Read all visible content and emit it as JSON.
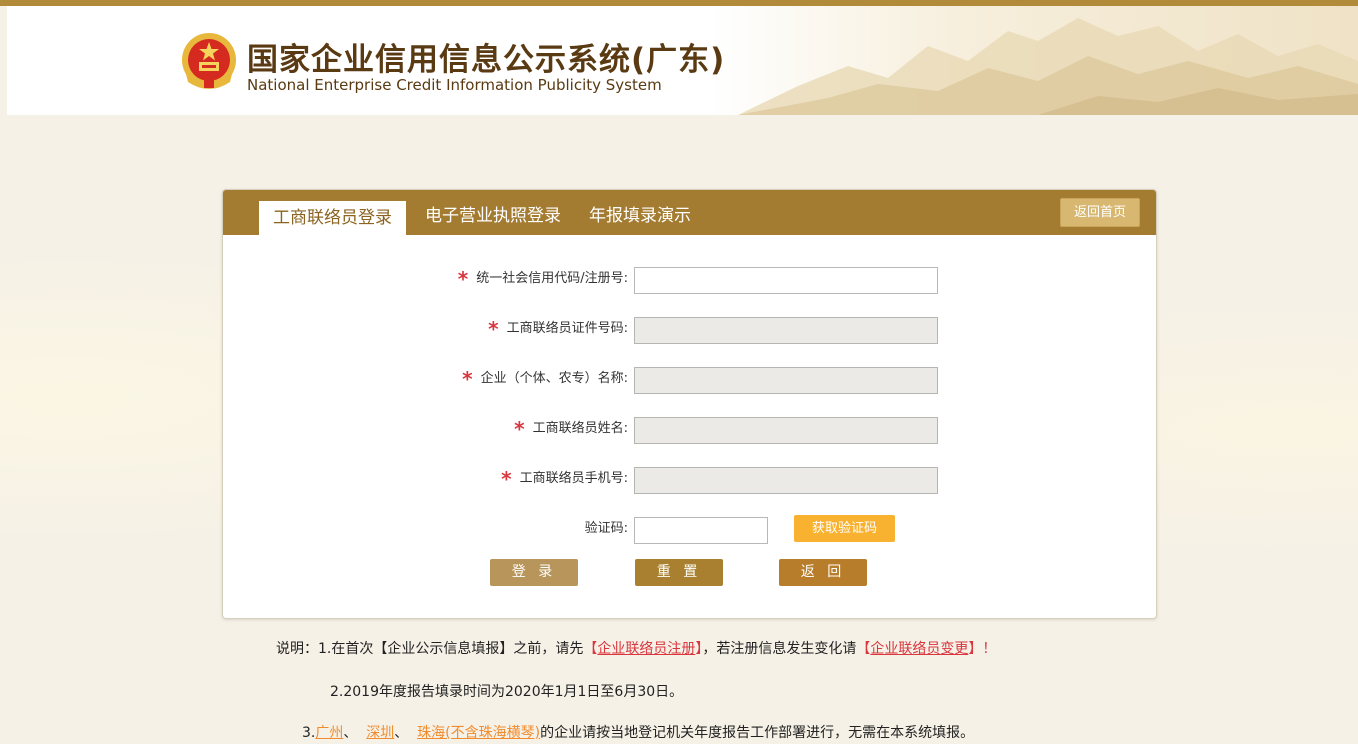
{
  "header": {
    "title": "国家企业信用信息公示系统(广东)",
    "subtitle": "National Enterprise Credit Information Publicity System"
  },
  "tabs": [
    {
      "label": "工商联络员登录",
      "active": true
    },
    {
      "label": "电子营业执照登录",
      "active": false
    },
    {
      "label": "年报填录演示",
      "active": false
    }
  ],
  "back_home": "返回首页",
  "form": {
    "fields": [
      {
        "label": "统一社会信用代码/注册号:",
        "required": true,
        "disabled": false,
        "value": ""
      },
      {
        "label": "工商联络员证件号码:",
        "required": true,
        "disabled": true,
        "value": ""
      },
      {
        "label": "企业（个体、农专）名称:",
        "required": true,
        "disabled": true,
        "value": ""
      },
      {
        "label": "工商联络员姓名:",
        "required": true,
        "disabled": true,
        "value": ""
      },
      {
        "label": "工商联络员手机号:",
        "required": true,
        "disabled": true,
        "value": ""
      }
    ],
    "captcha": {
      "label": "验证码:",
      "value": "",
      "button": "获取验证码"
    },
    "star": "*",
    "buttons": {
      "login": "登 录",
      "reset": "重 置",
      "back": "返 回"
    }
  },
  "notes": {
    "line1": {
      "prefix": "说明：1.在首次【企业公示信息填报】之前，请先",
      "link1_open": "【",
      "link1": "企业联络员注册",
      "link1_close": "】",
      "middle": "，若注册信息发生变化请",
      "link2_open": "【",
      "link2": "企业联络员变更",
      "link2_close": "】！"
    },
    "line2": "2.2019年度报告填录时间为2020年1月1日至6月30日。",
    "line3": {
      "prefix": "3.",
      "city1": "广州",
      "sep1": "、",
      "city2": "深圳",
      "sep2": "、",
      "city3": "珠海(不含珠海横琴)",
      "suffix": "的企业请按当地登记机关年度报告工作部署进行，无需在本系统填报。"
    }
  },
  "colors": {
    "brand": "#a47c31",
    "login_button": "#b8955a",
    "reset_button": "#a8802f",
    "back_button": "#b87d2a",
    "captcha_button": "#f9b230",
    "required": "#d9363e"
  },
  "icons": {
    "emblem": "national-emblem-icon"
  }
}
